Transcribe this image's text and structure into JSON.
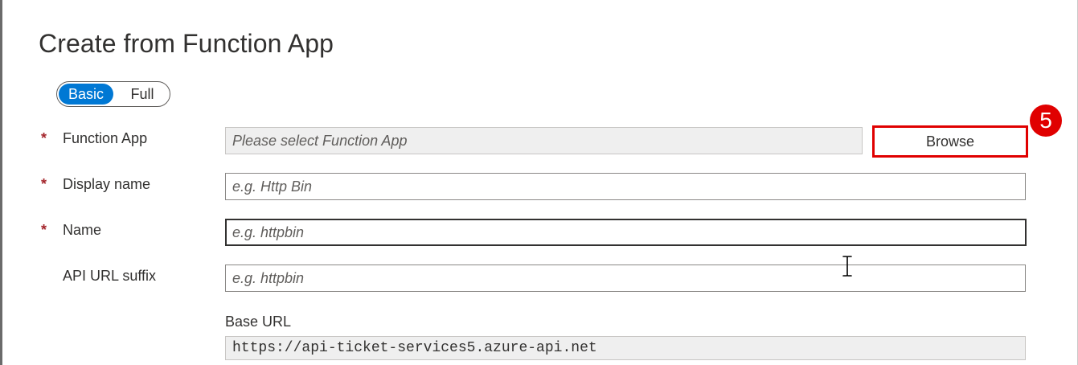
{
  "dialog": {
    "title": "Create from Function App"
  },
  "mode_toggle": {
    "options": [
      "Basic",
      "Full"
    ],
    "selected": "Basic",
    "accent_color": "#0078d4"
  },
  "form": {
    "required_marker": "*",
    "function_app": {
      "label": "Function App",
      "placeholder": "Please select Function App",
      "value": "",
      "required": true,
      "browse_label": "Browse",
      "step_number": "5",
      "highlight_color": "#e00000"
    },
    "display_name": {
      "label": "Display name",
      "placeholder": "e.g. Http Bin",
      "value": "",
      "required": true
    },
    "name": {
      "label": "Name",
      "placeholder": "e.g. httpbin",
      "value": "",
      "required": true
    },
    "api_url_suffix": {
      "label": "API URL suffix",
      "placeholder": "e.g. httpbin",
      "value": "",
      "required": false
    },
    "base_url": {
      "label": "Base URL",
      "value": "https://api-ticket-services5.azure-api.net"
    }
  },
  "cursor": {
    "icon": "text-ibeam-cursor-icon"
  }
}
